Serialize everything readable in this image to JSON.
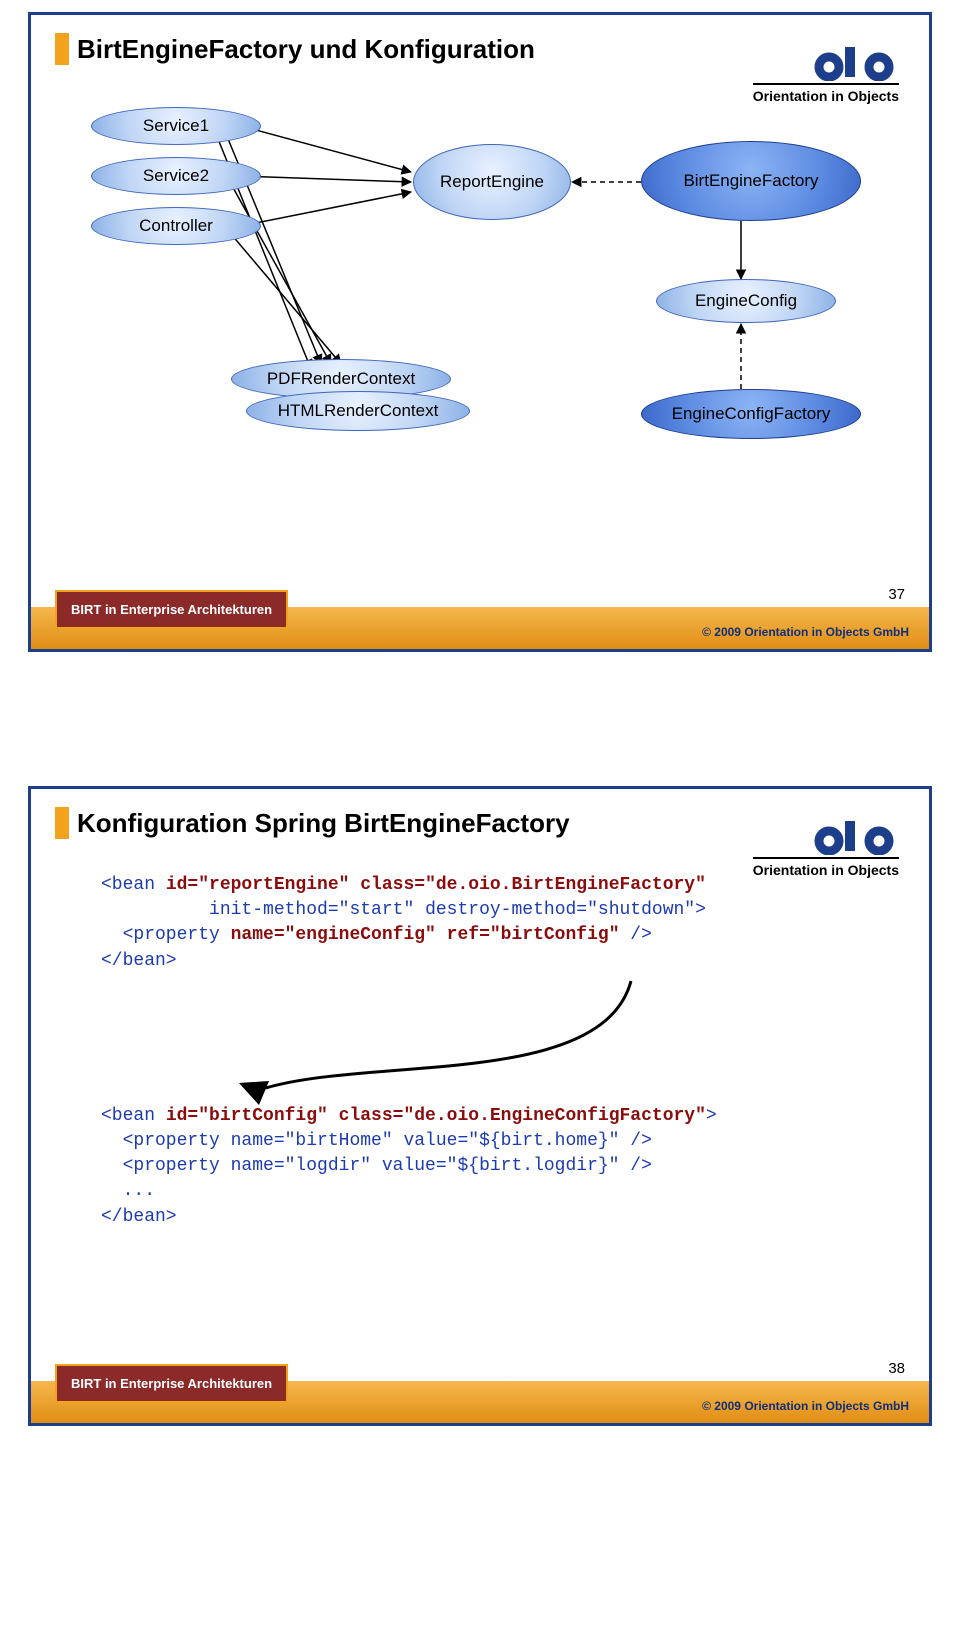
{
  "logo_sub": "Orientation in Objects",
  "footer_badge": "BIRT in Enterprise Architekturen",
  "footer_copy": "© 2009 Orientation in Objects GmbH",
  "slide1": {
    "title": "BirtEngineFactory und Konfiguration",
    "page": "37",
    "nodes": {
      "service1": "Service1",
      "service2": "Service2",
      "controller": "Controller",
      "report_engine": "ReportEngine",
      "birt_factory": "BirtEngineFactory",
      "pdf_ctx": "PDFRenderContext",
      "html_ctx": "HTMLRenderContext",
      "engine_config": "EngineConfig",
      "engine_config_factory": "EngineConfigFactory"
    }
  },
  "slide2": {
    "title": "Konfiguration Spring BirtEngineFactory",
    "page": "38",
    "code_bean1_open_1": "<bean ",
    "code_bean1_id_k": "id=\"reportEngine\"",
    "code_bean1_cls_k": " class=\"de.oio.BirtEngineFactory\"",
    "code_bean1_init": "          init-method=",
    "code_bean1_init_v": "\"start\"",
    "code_bean1_dest": " destroy-method=",
    "code_bean1_dest_v": "\"shutdown\"",
    "code_bean1_close": ">",
    "code_bean1_prop_open": "  <property ",
    "code_bean1_prop_name": "name=\"engineConfig\"",
    "code_bean1_prop_ref": " ref=\"birtConfig\"",
    "code_bean1_prop_close": " />",
    "code_bean1_end": "</bean>",
    "code_bean2_open_1": "<bean ",
    "code_bean2_id_k": "id=\"birtConfig\"",
    "code_bean2_cls_k": " class=\"de.oio.EngineConfigFactory\"",
    "code_bean2_close": ">",
    "code_bean2_p1_open": "  <property ",
    "code_bean2_p1": "name=\"birtHome\" value=\"${birt.home}\"",
    "code_bean2_p1_close": " />",
    "code_bean2_p2_open": "  <property ",
    "code_bean2_p2": "name=\"logdir\" value=\"${birt.logdir}\"",
    "code_bean2_p2_close": " />",
    "code_bean2_dots": "  ...",
    "code_bean2_end": "</bean>"
  }
}
